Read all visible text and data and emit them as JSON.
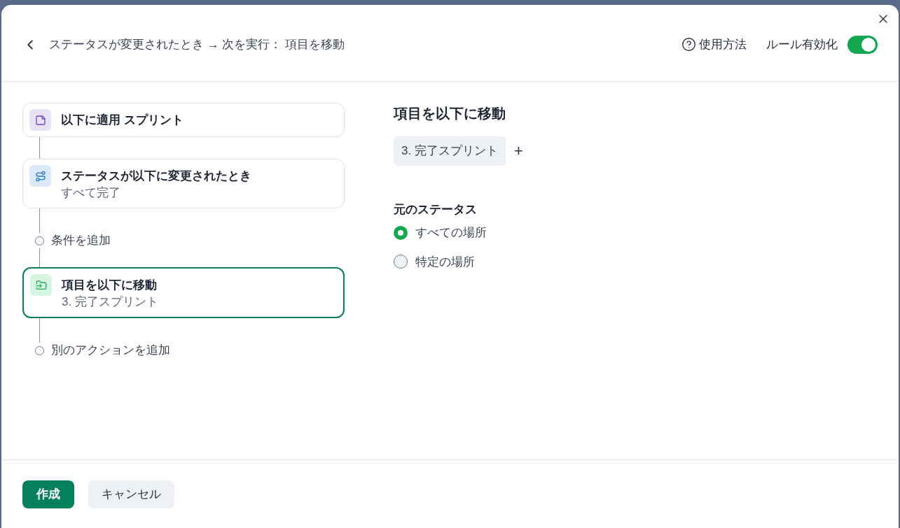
{
  "header": {
    "breadcrumb": "ステータスが変更されたとき → 次を実行： 項目を移動",
    "help": "使用方法",
    "toggle": {
      "label": "ルール有効化",
      "on": true
    }
  },
  "flow": [
    {
      "kind": "scope",
      "title": "以下に適用 スプリント",
      "selected": false
    },
    {
      "kind": "trigger",
      "title": "ステータスが以下に変更されたとき",
      "subtitle": "すべて完了",
      "selected": false
    },
    {
      "kind": "add",
      "label": "条件を追加"
    },
    {
      "kind": "action",
      "title": "項目を以下に移動",
      "subtitle": "3. 完了スプリント",
      "selected": true
    },
    {
      "kind": "add",
      "label": "別のアクションを追加"
    }
  ],
  "detail": {
    "title": "項目を以下に移動",
    "chips": [
      "3. 完了スプリント"
    ],
    "add": "+",
    "section": "元のステータス",
    "options": [
      {
        "label": "すべての場所",
        "selected": true
      },
      {
        "label": "特定の場所",
        "selected": false
      }
    ]
  },
  "footer": {
    "primary": "作成",
    "secondary": "キャンセル"
  }
}
